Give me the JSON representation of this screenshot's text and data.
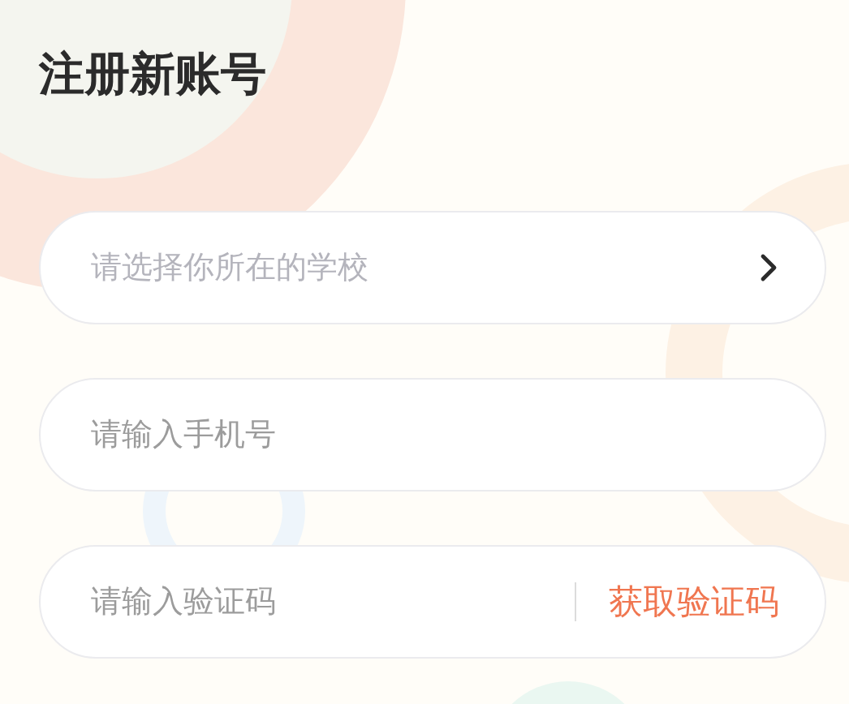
{
  "title": "注册新账号",
  "fields": [
    {
      "kind": "select",
      "placeholder": "请选择你所在的学校"
    },
    {
      "kind": "text",
      "placeholder": "请输入手机号"
    },
    {
      "kind": "code",
      "placeholder": "请输入验证码",
      "action": "获取验证码"
    }
  ]
}
